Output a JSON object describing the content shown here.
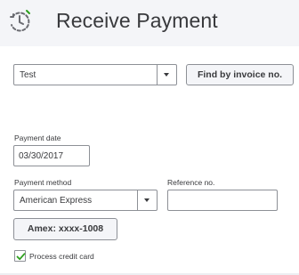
{
  "header": {
    "title": "Receive Payment",
    "icon": "receive-payment-icon",
    "icon_color": "#2ca01c"
  },
  "customer": {
    "value": "Test"
  },
  "find_invoice": {
    "label": "Find by invoice no."
  },
  "payment_date": {
    "label": "Payment date",
    "value": "03/30/2017"
  },
  "payment_method": {
    "label": "Payment method",
    "value": "American Express"
  },
  "reference": {
    "label": "Reference no.",
    "value": ""
  },
  "card_button": {
    "label": "Amex: xxxx-1008"
  },
  "process_card": {
    "label": "Process credit card",
    "checked": true,
    "check_color": "#2ca01c"
  }
}
